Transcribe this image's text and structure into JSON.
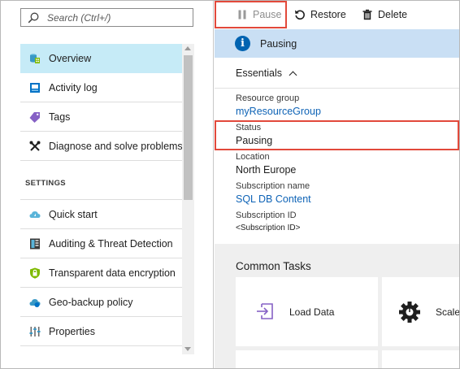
{
  "search": {
    "placeholder": "Search (Ctrl+/)"
  },
  "menu": {
    "items": [
      {
        "label": "Overview",
        "icon": "database-icon",
        "active": true
      },
      {
        "label": "Activity log",
        "icon": "activity-log-icon"
      },
      {
        "label": "Tags",
        "icon": "tag-icon"
      },
      {
        "label": "Diagnose and solve problems",
        "icon": "wrench-icon"
      }
    ],
    "settings_heading": "SETTINGS",
    "settings_items": [
      {
        "label": "Quick start",
        "icon": "cloud-icon"
      },
      {
        "label": "Auditing & Threat Detection",
        "icon": "auditing-icon"
      },
      {
        "label": "Transparent data encryption",
        "icon": "shield-icon"
      },
      {
        "label": "Geo-backup policy",
        "icon": "geo-backup-icon"
      },
      {
        "label": "Properties",
        "icon": "properties-icon"
      }
    ]
  },
  "toolbar": {
    "pause_label": "Pause",
    "restore_label": "Restore",
    "delete_label": "Delete"
  },
  "notification": {
    "text": "Pausing"
  },
  "essentials": {
    "title": "Essentials",
    "resource_group_label": "Resource group",
    "resource_group_value": "myResourceGroup",
    "status_label": "Status",
    "status_value": "Pausing",
    "location_label": "Location",
    "location_value": "North Europe",
    "subscription_name_label": "Subscription name",
    "subscription_name_value": "SQL DB Content",
    "subscription_id_label": "Subscription ID",
    "subscription_id_value": "<Subscription ID>"
  },
  "common_tasks": {
    "title": "Common Tasks",
    "tiles": [
      {
        "label": "Load Data",
        "icon": "import-icon"
      },
      {
        "label": "Scale",
        "icon": "gear-icon"
      }
    ]
  },
  "colors": {
    "active_item_bg": "#c6ebf7",
    "info_bar_bg": "#c9dff4",
    "link": "#0e63b6",
    "highlight": "#e2493b"
  }
}
